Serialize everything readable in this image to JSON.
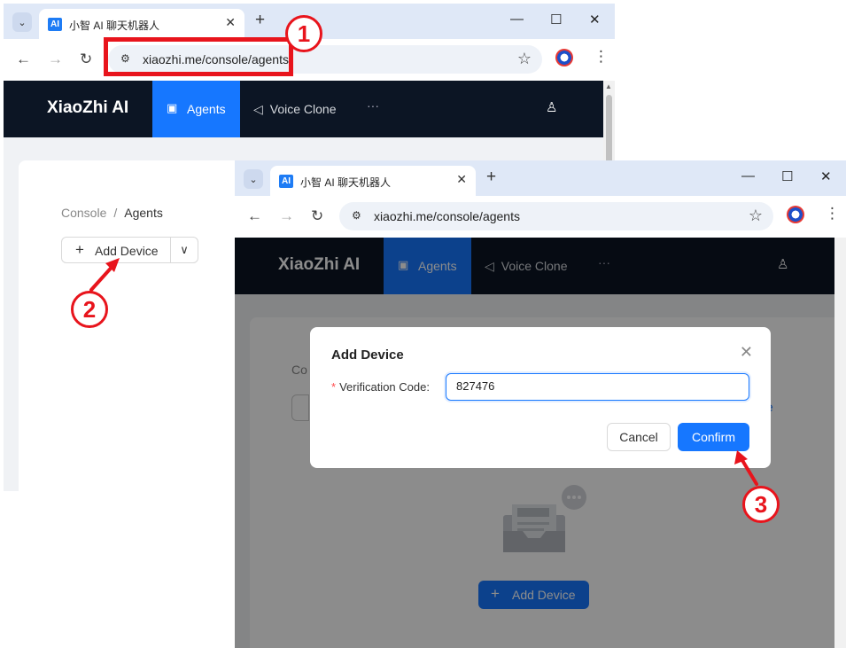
{
  "browser": {
    "tab_title": "小智 AI 聊天机器人",
    "favicon_text": "AI",
    "url": "xiaozhi.me/console/agents",
    "new_tab_symbol": "+",
    "tab_close_symbol": "✕",
    "controls": {
      "minimize": "—",
      "maximize": "☐",
      "close": "✕"
    }
  },
  "app": {
    "brand": "XiaoZhi AI",
    "nav": {
      "agents": "Agents",
      "voice_clone": "Voice Clone",
      "more": "···"
    },
    "breadcrumb": {
      "root": "Console",
      "separator": "/",
      "current": "Agents"
    },
    "add_device_label": "Add Device",
    "background_fragments": {
      "console": "Co",
      "link": "e"
    }
  },
  "dialog": {
    "title": "Add Device",
    "required_mark": "*",
    "label": "Verification Code:",
    "value": "827476",
    "cancel": "Cancel",
    "confirm": "Confirm"
  },
  "annotations": [
    "1",
    "2",
    "3"
  ],
  "colors": {
    "accent": "#1677ff",
    "nav_bg": "#0c1524",
    "annotation": "#e8141c"
  }
}
